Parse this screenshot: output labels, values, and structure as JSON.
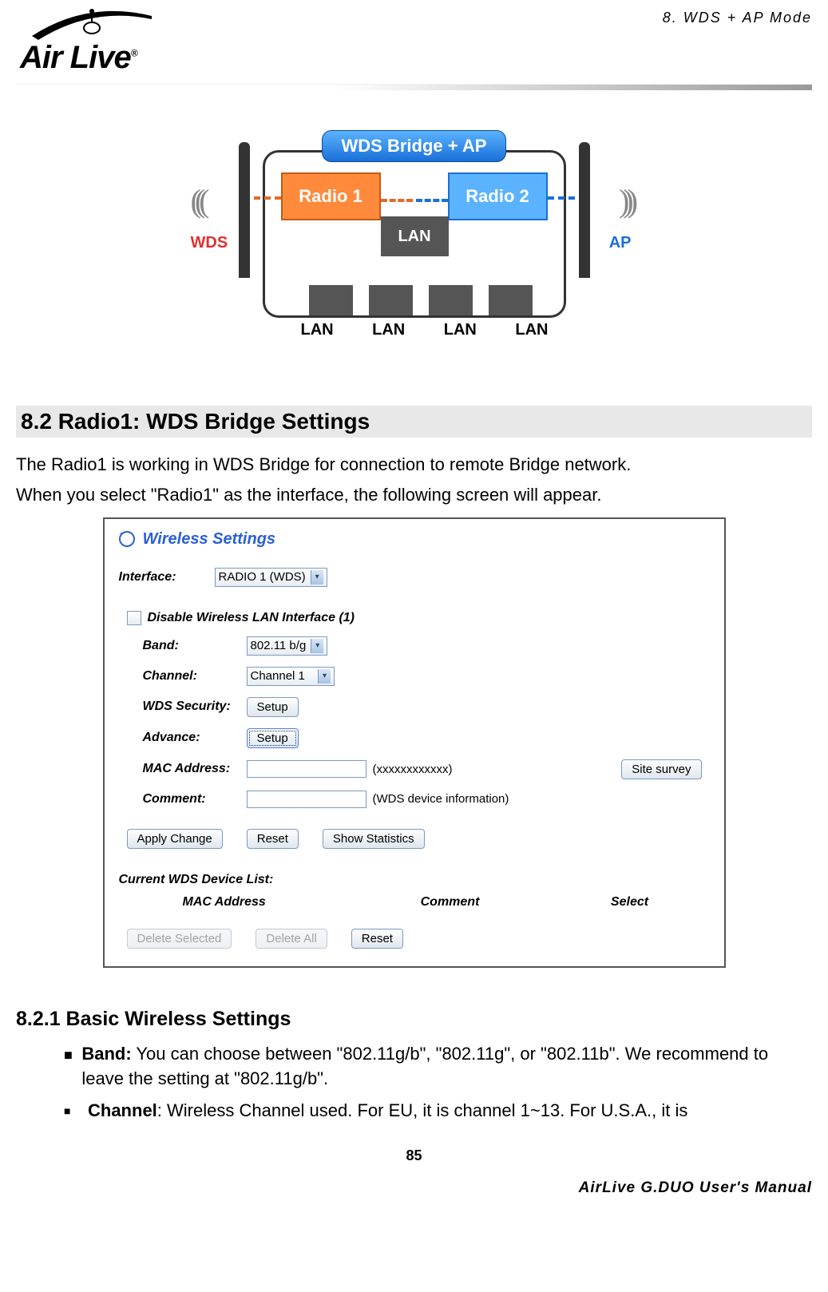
{
  "header": {
    "logo_text": "Air Live",
    "chapter": "8.  WDS  +  AP  Mode"
  },
  "diagram": {
    "badge": "WDS Bridge + AP",
    "radio1": "Radio 1",
    "radio2": "Radio 2",
    "lan_center": "LAN",
    "wds_label": "WDS",
    "ap_label": "AP",
    "lan_port_label": "LAN"
  },
  "section": {
    "heading": "8.2 Radio1:  WDS  Bridge  Settings",
    "para1": "The Radio1 is working in WDS Bridge for connection to remote Bridge network.",
    "para2": "When you select \"Radio1\" as the interface, the following screen will appear."
  },
  "screenshot": {
    "title": "Wireless Settings",
    "interface_label": "Interface:",
    "interface_value": "RADIO 1 (WDS)",
    "disable_label": "Disable Wireless LAN Interface (1)",
    "band_label": "Band:",
    "band_value": "802.11 b/g",
    "channel_label": "Channel:",
    "channel_value": "Channel 1",
    "wds_security_label": "WDS Security:",
    "wds_security_btn": "Setup",
    "advance_label": "Advance:",
    "advance_btn": "Setup",
    "mac_label": "MAC Address:",
    "mac_hint": "(xxxxxxxxxxxx)",
    "site_survey_btn": "Site survey",
    "comment_label": "Comment:",
    "comment_hint": "(WDS device information)",
    "apply_btn": "Apply Change",
    "reset_btn": "Reset",
    "stats_btn": "Show Statistics",
    "list_header": "Current WDS Device List:",
    "col_mac": "MAC Address",
    "col_comment": "Comment",
    "col_select": "Select",
    "del_sel_btn": "Delete Selected",
    "del_all_btn": "Delete All",
    "reset2_btn": "Reset"
  },
  "subsection": {
    "heading": "8.2.1 Basic Wireless Settings",
    "bullets": [
      {
        "marker": "■",
        "bold": "Band:",
        "text": "    You can choose between \"802.11g/b\", \"802.11g\", or \"802.11b\".    We recommend to leave the setting at \"802.11g/b\"."
      },
      {
        "marker": "■",
        "bold": "Channel",
        "text": ":    Wireless Channel used.    For EU, it is channel 1~13.    For U.S.A., it is"
      }
    ]
  },
  "footer": {
    "page": "85",
    "manual": "AirLive  G.DUO  User's  Manual"
  }
}
